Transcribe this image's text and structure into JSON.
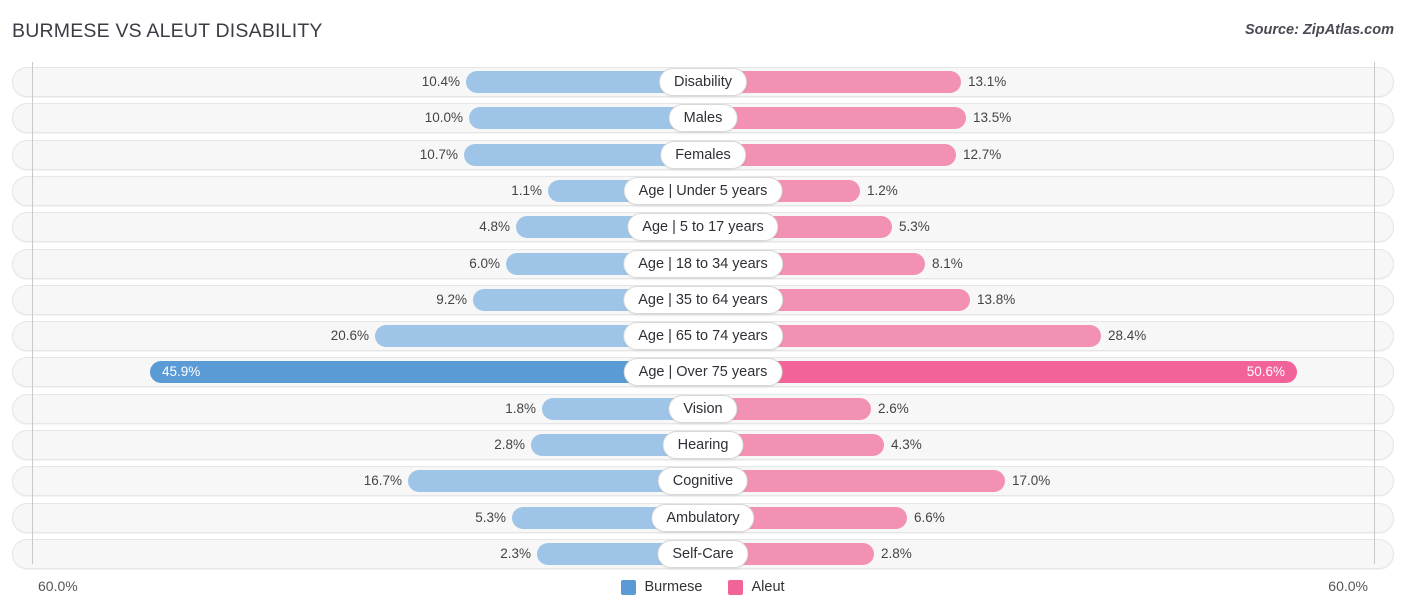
{
  "header": {
    "title": "BURMESE VS ALEUT DISABILITY",
    "source": "Source: ZipAtlas.com"
  },
  "legend": {
    "items": [
      {
        "label": "Burmese",
        "color": "#5b9bd5"
      },
      {
        "label": "Aleut",
        "color": "#f2639a"
      }
    ]
  },
  "axis": {
    "left_max": "60.0%",
    "right_max": "60.0%"
  },
  "chart_data": {
    "type": "bar",
    "title": "BURMESE VS ALEUT DISABILITY",
    "subtype": "diverging-bar",
    "xlabel": "",
    "ylabel": "",
    "xlim": [
      60.0,
      60.0
    ],
    "grid": false,
    "legend_position": "bottom-center",
    "categories": [
      "Disability",
      "Males",
      "Females",
      "Age | Under 5 years",
      "Age | 5 to 17 years",
      "Age | 18 to 34 years",
      "Age | 35 to 64 years",
      "Age | 65 to 74 years",
      "Age | Over 75 years",
      "Vision",
      "Hearing",
      "Cognitive",
      "Ambulatory",
      "Self-Care"
    ],
    "series": [
      {
        "name": "Burmese",
        "color": "#9ec5e8",
        "values": [
          10.4,
          10.0,
          10.7,
          1.1,
          4.8,
          6.0,
          9.2,
          20.6,
          45.9,
          1.8,
          2.8,
          16.7,
          5.3,
          2.3
        ],
        "labels": [
          "10.4%",
          "10.0%",
          "10.7%",
          "1.1%",
          "4.8%",
          "6.0%",
          "9.2%",
          "20.6%",
          "45.9%",
          "1.8%",
          "2.8%",
          "16.7%",
          "5.3%",
          "2.3%"
        ]
      },
      {
        "name": "Aleut",
        "color": "#f291b4",
        "values": [
          13.1,
          13.5,
          12.7,
          1.2,
          5.3,
          8.1,
          13.8,
          28.4,
          50.6,
          2.6,
          4.3,
          17.0,
          6.6,
          2.8
        ],
        "labels": [
          "13.1%",
          "13.5%",
          "12.7%",
          "1.2%",
          "5.3%",
          "8.1%",
          "13.8%",
          "28.4%",
          "50.6%",
          "2.6%",
          "4.3%",
          "17.0%",
          "6.6%",
          "2.8%"
        ]
      }
    ],
    "highlighted_category": "Age | Over 75 years"
  },
  "rows": [
    {
      "label": "Disability",
      "left_label": "10.4%",
      "right_label": "13.1%",
      "left_start": 466,
      "right_end": 961,
      "highlight": false
    },
    {
      "label": "Males",
      "left_label": "10.0%",
      "right_label": "13.5%",
      "left_start": 469,
      "right_end": 966,
      "highlight": false
    },
    {
      "label": "Females",
      "left_label": "10.7%",
      "right_label": "12.7%",
      "left_start": 464,
      "right_end": 956,
      "highlight": false
    },
    {
      "label": "Age | Under 5 years",
      "left_label": "1.1%",
      "right_label": "1.2%",
      "left_start": 548,
      "right_end": 860,
      "highlight": false
    },
    {
      "label": "Age | 5 to 17 years",
      "left_label": "4.8%",
      "right_label": "5.3%",
      "left_start": 516,
      "right_end": 892,
      "highlight": false
    },
    {
      "label": "Age | 18 to 34 years",
      "left_label": "6.0%",
      "right_label": "8.1%",
      "left_start": 506,
      "right_end": 925,
      "highlight": false
    },
    {
      "label": "Age | 35 to 64 years",
      "left_label": "9.2%",
      "right_label": "13.8%",
      "left_start": 473,
      "right_end": 970,
      "highlight": false
    },
    {
      "label": "Age | 65 to 74 years",
      "left_label": "20.6%",
      "right_label": "28.4%",
      "left_start": 375,
      "right_end": 1101,
      "highlight": false
    },
    {
      "label": "Age | Over 75 years",
      "left_label": "45.9%",
      "right_label": "50.6%",
      "left_start": 150,
      "right_end": 1297,
      "highlight": true
    },
    {
      "label": "Vision",
      "left_label": "1.8%",
      "right_label": "2.6%",
      "left_start": 542,
      "right_end": 871,
      "highlight": false
    },
    {
      "label": "Hearing",
      "left_label": "2.8%",
      "right_label": "4.3%",
      "left_start": 531,
      "right_end": 884,
      "highlight": false
    },
    {
      "label": "Cognitive",
      "left_label": "16.7%",
      "right_label": "17.0%",
      "left_start": 408,
      "right_end": 1005,
      "highlight": false
    },
    {
      "label": "Ambulatory",
      "left_label": "5.3%",
      "right_label": "6.6%",
      "left_start": 512,
      "right_end": 907,
      "highlight": false
    },
    {
      "label": "Self-Care",
      "left_label": "2.3%",
      "right_label": "2.8%",
      "left_start": 537,
      "right_end": 874,
      "highlight": false
    }
  ]
}
